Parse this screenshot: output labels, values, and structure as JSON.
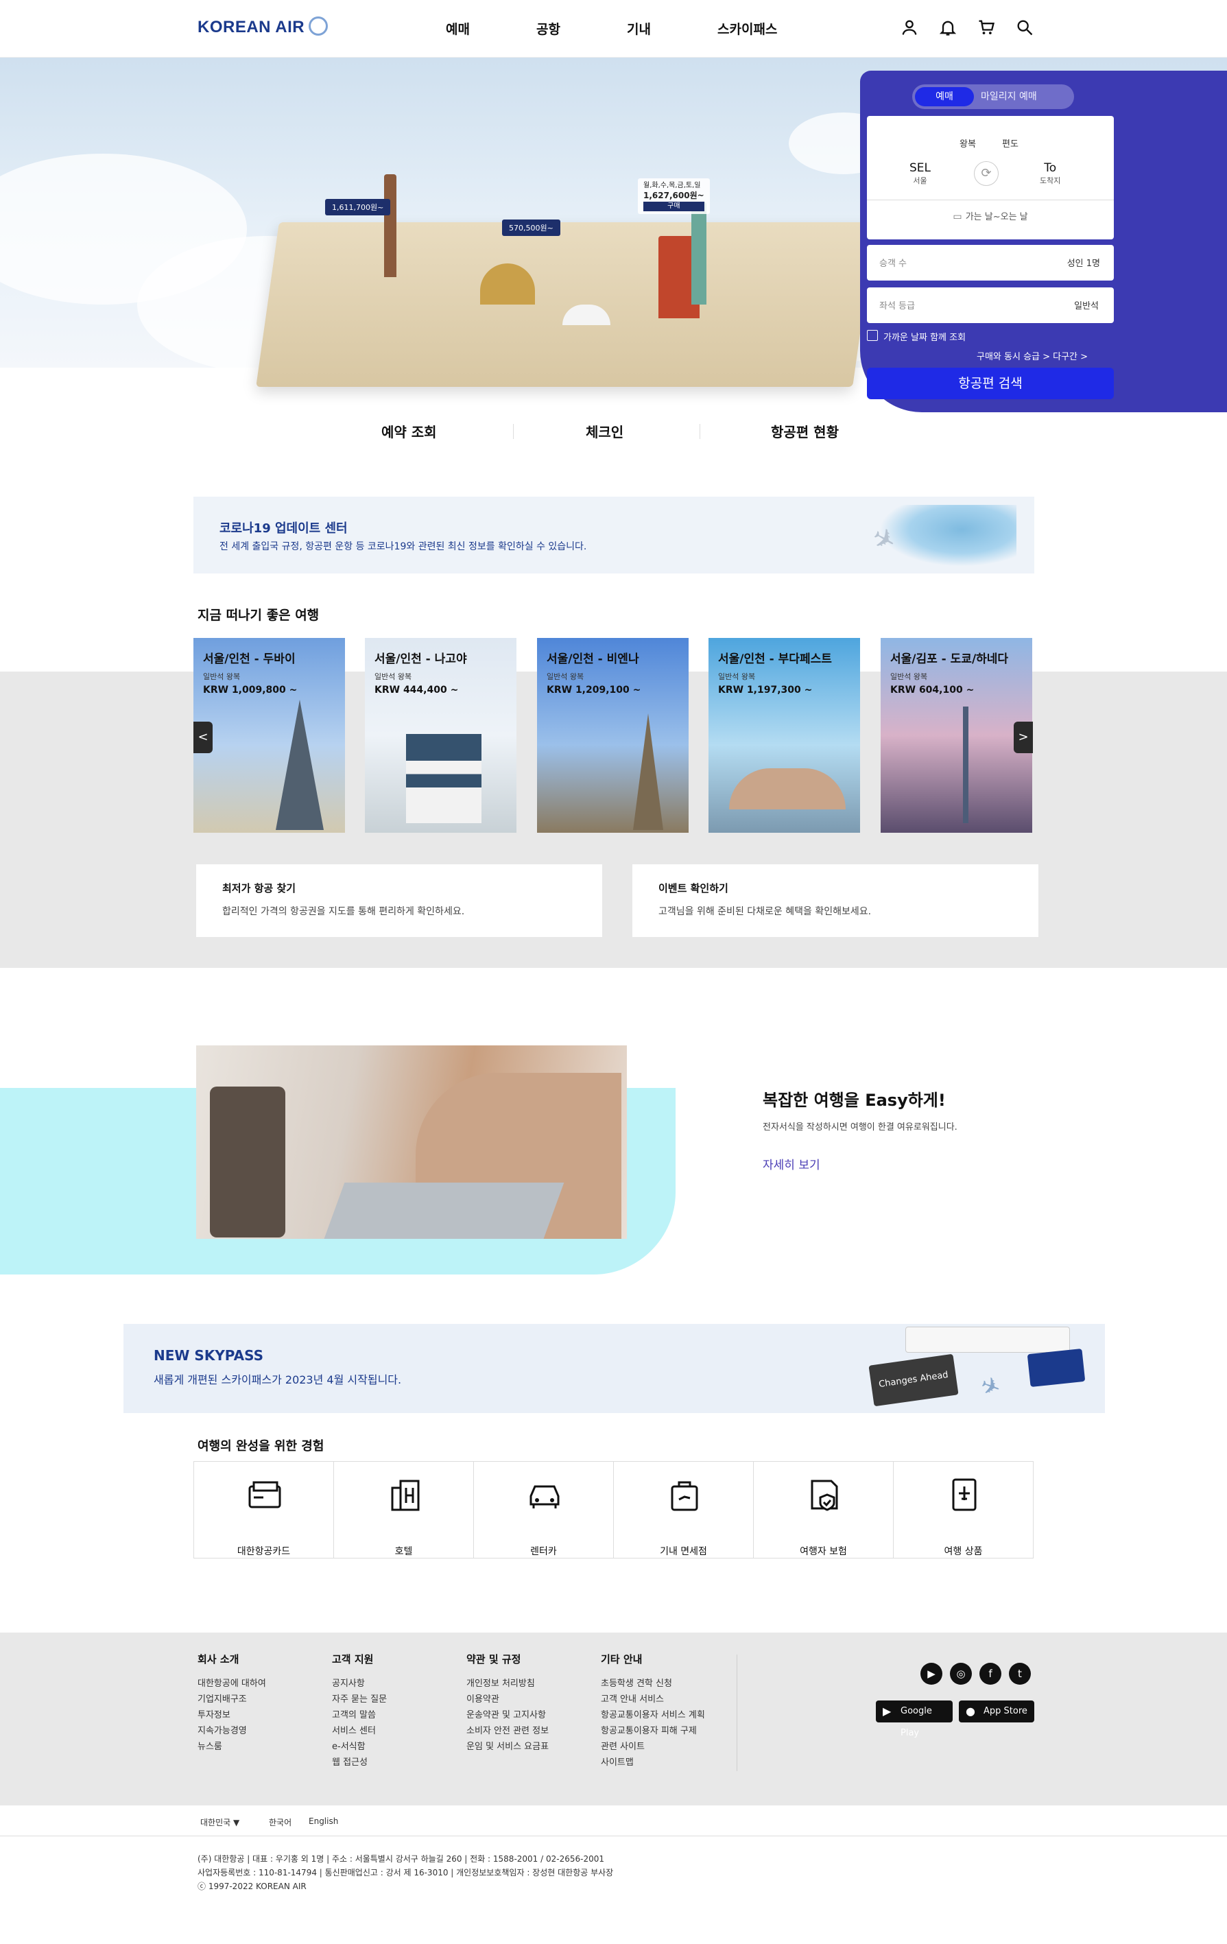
{
  "header": {
    "logo": "KOREAN AIR",
    "nav": [
      "예매",
      "공항",
      "기내",
      "스카이패스"
    ],
    "icons": [
      "user-icon",
      "bell-icon",
      "cart-icon",
      "search-icon"
    ]
  },
  "hero": {
    "price_tags": [
      "1,611,700원~",
      "570,500원~",
      "1,627,600원~"
    ],
    "price_tag_caption": "월,화,수,목,금,토,일",
    "price_tag_button": "구매"
  },
  "booking": {
    "tabs": [
      "예매",
      "마일리지 예매"
    ],
    "trip_types": [
      "왕복",
      "편도"
    ],
    "from_code": "SEL",
    "from_city": "서울",
    "to_code": "To",
    "to_city": "도착지",
    "date_placeholder": "가는 날~오는 날",
    "passenger_label": "승객 수",
    "passenger_value": "성인 1명",
    "class_label": "좌석 등급",
    "class_value": "일반석",
    "nearby_label": "가까운 날짜 함께 조회",
    "extra_links": "구매와 동시 승급 > 다구간 >",
    "search_button": "항공편 검색"
  },
  "quick_links": [
    "예약 조회",
    "체크인",
    "항공편 현황"
  ],
  "covid": {
    "title": "코로나19 업데이트 센터",
    "desc": "전 세계 출입국 규정, 항공편 운항 등 코로나19와 관련된 최신 정보를 확인하실 수 있습니다."
  },
  "trips": {
    "heading": "지금 떠나기 좋은 여행",
    "prev": "<",
    "next": ">",
    "cards": [
      {
        "route": "서울/인천 - 두바이",
        "class": "일반석 왕복",
        "price": "KRW 1,009,800 ~"
      },
      {
        "route": "서울/인천 - 나고야",
        "class": "일반석 왕복",
        "price": "KRW 444,400 ~"
      },
      {
        "route": "서울/인천 - 비엔나",
        "class": "일반석 왕복",
        "price": "KRW 1,209,100 ~"
      },
      {
        "route": "서울/인천 - 부다페스트",
        "class": "일반석 왕복",
        "price": "KRW 1,197,300 ~"
      },
      {
        "route": "서울/김포 - 도쿄/하네다",
        "class": "일반석 왕복",
        "price": "KRW 604,100 ~"
      }
    ]
  },
  "info_boxes": [
    {
      "title": "최저가 항공 찾기",
      "desc": "합리적인 가격의 항공권을 지도를 통해 편리하게 확인하세요."
    },
    {
      "title": "이벤트 확인하기",
      "desc": "고객님을 위해 준비된 다채로운 혜택을 확인해보세요."
    }
  ],
  "easy": {
    "title": "복잡한 여행을 Easy하게!",
    "desc": "전자서식을 작성하시면 여행이 한결 여유로워집니다.",
    "link": "자세히 보기"
  },
  "skypass": {
    "title": "NEW SKYPASS",
    "desc": "새롭게 개편된 스카이패스가 2023년 4월 시작됩니다.",
    "card_text": "Changes Ahead"
  },
  "experience": {
    "heading": "여행의 완성을 위한 경험",
    "items": [
      "대한항공카드",
      "호텔",
      "렌터카",
      "기내 면세점",
      "여행자 보험",
      "여행 상품"
    ]
  },
  "footer": {
    "columns": [
      {
        "title": "회사 소개",
        "items": [
          "대한항공에 대하여",
          "기업지배구조",
          "투자정보",
          "지속가능경영",
          "뉴스룸"
        ]
      },
      {
        "title": "고객 지원",
        "items": [
          "공지사항",
          "자주 묻는 질문",
          "고객의 말씀",
          "서비스 센터",
          "e-서식함",
          "웹 접근성"
        ]
      },
      {
        "title": "약관 및 규정",
        "items": [
          "개인정보 처리방침",
          "이용약관",
          "운송약관 및 고지사항",
          "소비자 안전 관련 정보",
          "운임 및 서비스 요금표"
        ]
      },
      {
        "title": "기타 안내",
        "items": [
          "초등학생 견학 신청",
          "고객 안내 서비스",
          "항공교통이용자 서비스 계획",
          "항공교통이용자 피해 구제",
          "관련 사이트",
          "사이트맵"
        ]
      }
    ],
    "social": [
      "youtube-icon",
      "instagram-icon",
      "facebook-icon",
      "twitter-icon"
    ],
    "stores": [
      "Google Play",
      "App Store"
    ],
    "region": "대한민국",
    "languages": [
      "한국어",
      "English"
    ],
    "company_line": "(주) 대한항공 | 대표 : 우기홍 외 1명 | 주소 : 서울특별시 강서구 하늘길 260 | 전화 : 1588-2001 / 02-2656-2001",
    "reg_line": "사업자등록번호 : 110-81-14794 | 통신판매업신고 : 강서 제 16-3010 | 개인정보보호책임자 : 장성현 대한항공 부사장",
    "copyright": "ⓒ 1997-2022 KOREAN AIR"
  },
  "colors": {
    "brand": "#1b3a8c",
    "booking_panel": "#3c3ab2",
    "primary_button": "#1f2ae6",
    "easy_bg": "#bdf3f8"
  }
}
